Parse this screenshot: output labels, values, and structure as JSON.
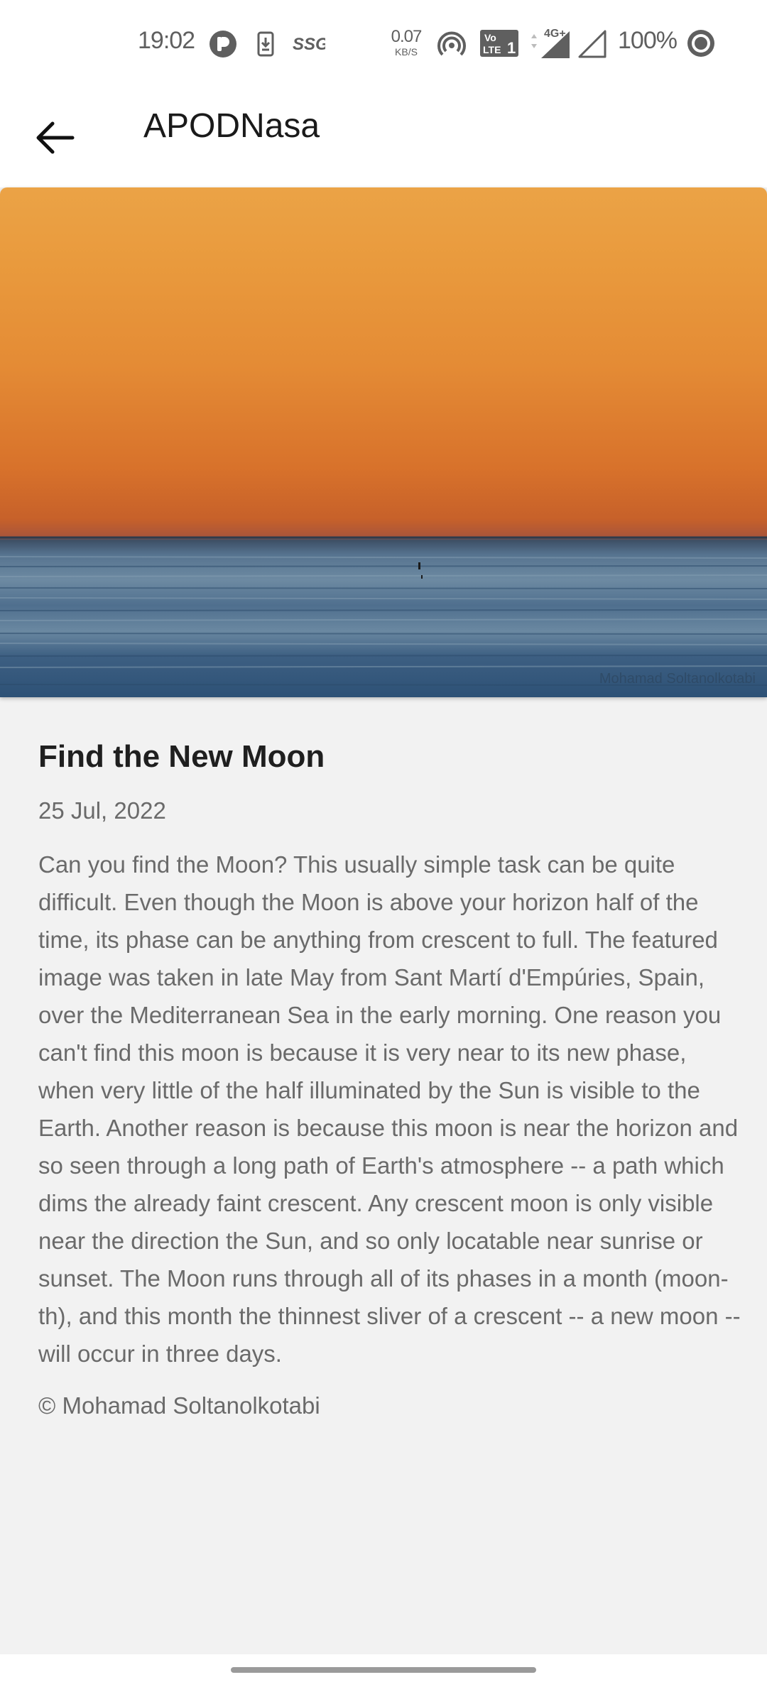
{
  "status_bar": {
    "time": "19:02",
    "net_speed_value": "0.07",
    "net_speed_unit": "KB/S",
    "network_type": "4G+",
    "battery": "100%",
    "icons": [
      "p-app-icon",
      "download-icon",
      "ssg-icon",
      "hotspot-icon",
      "volte-icon",
      "signal-icon",
      "signal-empty-icon",
      "record-icon"
    ],
    "volte_top": "Vo",
    "volte_bottom": "LTE",
    "volte_sim": "1",
    "ssg_label": "SSG"
  },
  "app_bar": {
    "title": "APODNasa",
    "back_icon": "arrow-back-icon"
  },
  "hero": {
    "credit_watermark": "Mohamad Soltanolkotabi"
  },
  "post": {
    "title": "Find the New Moon",
    "date": "25 Jul, 2022",
    "explanation": "Can you find the Moon? This usually simple task can be quite difficult.  Even though the Moon is above your horizon half of the time, its phase can be anything from crescent to full. The featured image was taken in late May from Sant Martí d'Empúries, Spain, over the Mediterranean Sea in the early morning. One reason you can't find this moon is because it is very near to its new phase, when very little of the half illuminated by the Sun is visible to the Earth. Another reason is because this moon is near the horizon and so seen through a long path of Earth's atmosphere -- a path which dims the already faint crescent. Any crescent moon is only visible near the direction the Sun, and so only locatable near sunrise or sunset. The Moon runs through all of its phases in a month (moon-th), and this month the thinnest sliver of a crescent -- a new moon -- will occur in three days.",
    "copyright": "© Mohamad Soltanolkotabi"
  }
}
